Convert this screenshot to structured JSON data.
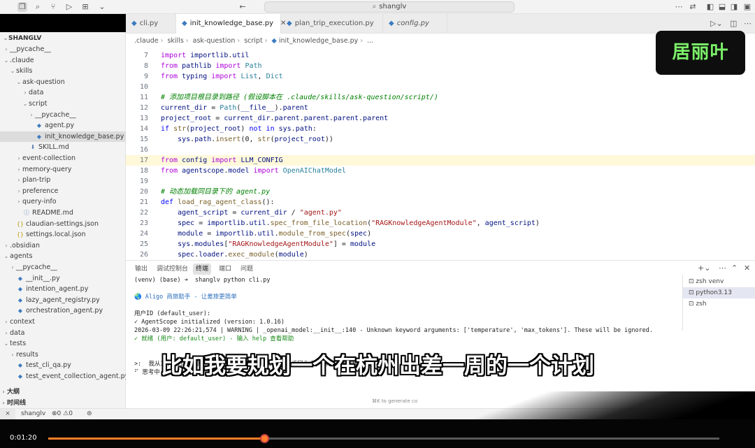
{
  "titlebar": {
    "search_text": "shanglv"
  },
  "sidebar": {
    "title": "SHANGLV",
    "items": [
      {
        "label": "__pycache__",
        "chev": "›",
        "icon": "",
        "level": 1
      },
      {
        "label": ".claude",
        "chev": "⌄",
        "icon": "",
        "level": 1
      },
      {
        "label": "skills",
        "chev": "⌄",
        "icon": "",
        "level": 2
      },
      {
        "label": "ask-question",
        "chev": "⌄",
        "icon": "",
        "level": 3
      },
      {
        "label": "data",
        "chev": "›",
        "icon": "",
        "level": 4
      },
      {
        "label": "script",
        "chev": "⌄",
        "icon": "",
        "level": 4
      },
      {
        "label": "__pycache__",
        "chev": "›",
        "icon": "",
        "level": 5
      },
      {
        "label": "agent.py",
        "chev": "",
        "icon": "py",
        "level": 5
      },
      {
        "label": "init_knowledge_base.py",
        "chev": "",
        "icon": "py",
        "level": 5,
        "selected": true
      },
      {
        "label": "SKILL.md",
        "chev": "",
        "icon": "md",
        "level": 4
      },
      {
        "label": "event-collection",
        "chev": "›",
        "icon": "",
        "level": 3
      },
      {
        "label": "memory-query",
        "chev": "›",
        "icon": "",
        "level": 3
      },
      {
        "label": "plan-trip",
        "chev": "›",
        "icon": "",
        "level": 3
      },
      {
        "label": "preference",
        "chev": "›",
        "icon": "",
        "level": 3
      },
      {
        "label": "query-info",
        "chev": "›",
        "icon": "",
        "level": 3
      },
      {
        "label": "README.md",
        "chev": "",
        "icon": "info",
        "level": 3
      },
      {
        "label": "claudian-settings.json",
        "chev": "",
        "icon": "json",
        "level": 2
      },
      {
        "label": "settings.local.json",
        "chev": "",
        "icon": "json",
        "level": 2
      },
      {
        "label": ".obsidian",
        "chev": "›",
        "icon": "",
        "level": 1
      },
      {
        "label": "agents",
        "chev": "⌄",
        "icon": "",
        "level": 1
      },
      {
        "label": "__pycache__",
        "chev": "›",
        "icon": "",
        "level": 2
      },
      {
        "label": "__init__.py",
        "chev": "",
        "icon": "py",
        "level": 2
      },
      {
        "label": "intention_agent.py",
        "chev": "",
        "icon": "py",
        "level": 2
      },
      {
        "label": "lazy_agent_registry.py",
        "chev": "",
        "icon": "py",
        "level": 2
      },
      {
        "label": "orchestration_agent.py",
        "chev": "",
        "icon": "py",
        "level": 2
      },
      {
        "label": "context",
        "chev": "›",
        "icon": "",
        "level": 1
      },
      {
        "label": "data",
        "chev": "›",
        "icon": "",
        "level": 1
      },
      {
        "label": "tests",
        "chev": "⌄",
        "icon": "",
        "level": 1
      },
      {
        "label": "results",
        "chev": "›",
        "icon": "",
        "level": 2
      },
      {
        "label": "test_cli_qa.py",
        "chev": "",
        "icon": "py",
        "level": 2
      },
      {
        "label": "test_event_collection_agent.py",
        "chev": "",
        "icon": "py",
        "level": 2
      }
    ],
    "outline_label": "大纲",
    "timeline_label": "时间线"
  },
  "tabs": [
    {
      "label": "cli.py",
      "active": false,
      "italic": false
    },
    {
      "label": "init_knowledge_base.py",
      "active": true,
      "italic": false
    },
    {
      "label": "plan_trip_execution.py",
      "active": false,
      "italic": false
    },
    {
      "label": "config.py",
      "active": false,
      "italic": true
    }
  ],
  "breadcrumb": [
    ".claude",
    "skills",
    "ask-question",
    "script",
    "init_knowledge_base.py",
    "..."
  ],
  "editor": {
    "lines": [
      {
        "n": "7",
        "html": "<span class='k'>import</span> <span class='v'>importlib</span>.<span class='v'>util</span>"
      },
      {
        "n": "8",
        "html": "<span class='k'>from</span> <span class='v'>pathlib</span> <span class='k'>import</span> <span class='cl'>Path</span>"
      },
      {
        "n": "9",
        "html": "<span class='k'>from</span> <span class='v'>typing</span> <span class='k'>import</span> <span class='cl'>List</span>, <span class='cl'>Dict</span>"
      },
      {
        "n": "10",
        "html": ""
      },
      {
        "n": "11",
        "html": "<span class='c'># 添加项目根目录到路径 (假设脚本在 .claude/skills/ask-question/script/)</span>"
      },
      {
        "n": "12",
        "html": "<span class='v'>current_dir</span> = <span class='cl'>Path</span>(<span class='v'>__file__</span>).<span class='v'>parent</span>"
      },
      {
        "n": "13",
        "html": "<span class='v'>project_root</span> = <span class='v'>current_dir</span>.<span class='v'>parent</span>.<span class='v'>parent</span>.<span class='v'>parent</span>.<span class='v'>parent</span>"
      },
      {
        "n": "14",
        "html": "<span class='kb'>if</span> <span class='f'>str</span>(<span class='v'>project_root</span>) <span class='kb'>not in</span> <span class='v'>sys</span>.<span class='v'>path</span>:"
      },
      {
        "n": "15",
        "html": "    <span class='v'>sys</span>.<span class='v'>path</span>.<span class='f'>insert</span>(0, <span class='f'>str</span>(<span class='v'>project_root</span>))"
      },
      {
        "n": "16",
        "html": ""
      },
      {
        "n": "17",
        "html": "<span class='k'>from</span> <span class='v'>config</span> <span class='k'>import</span> <span class='v'>LLM_CONFIG</span>",
        "hl": true
      },
      {
        "n": "18",
        "html": "<span class='k'>from</span> <span class='v'>agentscope</span>.<span class='v'>model</span> <span class='k'>import</span> <span class='cl'>OpenAIChatModel</span>"
      },
      {
        "n": "19",
        "html": ""
      },
      {
        "n": "20",
        "html": "<span class='c'># 动态加载同目录下的 agent.py</span>"
      },
      {
        "n": "21",
        "html": "<span class='kb'>def</span> <span class='f'>load_rag_agent_class</span>():"
      },
      {
        "n": "22",
        "html": "    <span class='v'>agent_script</span> = <span class='v'>current_dir</span> / <span class='s'>\"agent.py\"</span>"
      },
      {
        "n": "23",
        "html": "    <span class='v'>spec</span> = <span class='v'>importlib</span>.<span class='v'>util</span>.<span class='f'>spec_from_file_location</span>(<span class='s'>\"RAGKnowledgeAgentModule\"</span>, <span class='v'>agent_script</span>)"
      },
      {
        "n": "24",
        "html": "    <span class='v'>module</span> = <span class='v'>importlib</span>.<span class='v'>util</span>.<span class='f'>module_from_spec</span>(<span class='v'>spec</span>)"
      },
      {
        "n": "25",
        "html": "    <span class='v'>sys</span>.<span class='v'>modules</span>[<span class='s'>\"RAGKnowledgeAgentModule\"</span>] = <span class='v'>module</span>"
      },
      {
        "n": "26",
        "html": "    <span class='v'>spec</span>.<span class='v'>loader</span>.<span class='f'>exec_module</span>(<span class='v'>module</span>)"
      }
    ]
  },
  "watermark": "居丽叶",
  "panel": {
    "tabs": [
      "输出",
      "调试控制台",
      "终端",
      "端口",
      "问题"
    ],
    "active_tab": 2,
    "terminal": [
      {
        "text": "(venv) (base) ➜  shanglv python cli.py",
        "cls": ""
      },
      {
        "text": "",
        "cls": ""
      },
      {
        "text": "🌏 Aligo 商旅助手 - 让差旅更简单",
        "cls": "blueglobe"
      },
      {
        "text": "",
        "cls": ""
      },
      {
        "text": "用户ID (default_user):",
        "cls": ""
      },
      {
        "text": "✓ AgentScope initialized (version: 1.0.16)",
        "cls": ""
      },
      {
        "text": "2026-03-09 22:26:21,574 | WARNING | _openai_model:__init__:140 - Unknown keyword arguments: ['temperature', 'max_tokens']. These will be ignored.",
        "cls": ""
      },
      {
        "text": "✓ 就绪 (用户: default_user) - 输入 help 查看帮助",
        "cls": "green"
      },
      {
        "text": "",
        "cls": ""
      },
      {
        "text": "",
        "cls": ""
      },
      {
        "text": ">:  我从3月11日从北京出发, 在杭州出差一周, 3月18日返回北京, 帮我安排行程",
        "cls": ""
      },
      {
        "text": "⠋ 思考中",
        "cls": ""
      }
    ],
    "hint": "⌘K to generate co",
    "terminals": [
      "zsh  venv",
      "python3.13",
      "zsh"
    ]
  },
  "statusbar": {
    "branch": "shanglv",
    "errors": "0",
    "warnings": "0"
  },
  "subtitle": "比如我要规划一个在杭州出差一周的一个计划",
  "video": {
    "time": "0:01:20",
    "progress": 0.322
  }
}
